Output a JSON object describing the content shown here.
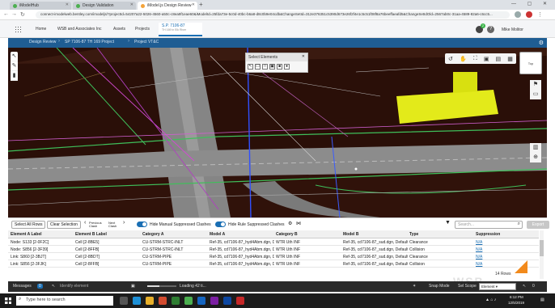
{
  "browser": {
    "tabs": [
      {
        "label": "iModelHub"
      },
      {
        "label": "Design Validation"
      },
      {
        "label": "iModel.js Design Review"
      }
    ],
    "url": "connect-imodelweb.bentley.com/imodeljs/?projectId=54207a22-5026-4560-a50c-c8ea9f1eae60&iModelId=25fda73e-5c0d-40bc-b6a8-d8c0b9e04cdb&ChangeSetId=312e376351c5390d673e26f2f4e1c5c51f08f8a76beeffaeafd5&ChangeSetIdOld=2567ab0c-31aa-4589-82a6-c6cc5..."
  },
  "app": {
    "nav": [
      "Home",
      "WSB and Associates Inc",
      "Assets",
      "Projects"
    ],
    "project_title": "S.P. 7106-87",
    "project_subtitle": "TH 169 in Elk River",
    "notification_count": "2",
    "help_label": "?",
    "user": "Mike Molitor"
  },
  "review_bar": {
    "breadcrumbs": [
      "Design Review",
      "SP 7106-87 TH 169 Project",
      "Project VT&C"
    ]
  },
  "select_panel": {
    "title": "Select Elements",
    "tools": [
      "↖",
      "☐",
      "□",
      "▣",
      "■",
      "●"
    ]
  },
  "view_tools": [
    "↺",
    "✋",
    "⛶",
    "▣",
    "▤",
    "▦"
  ],
  "cube_label": "Top",
  "grid_toolbar": {
    "select_all": "Select All Rows",
    "clear_selection": "Clear Selection",
    "previous": "Previous Clash",
    "next": "Next Clash",
    "hide_manual": "Hide Manual Suppressed Clashes",
    "hide_rule": "Hide Rule Suppressed Clashes",
    "search_placeholder": "Search...",
    "export": "Export"
  },
  "grid": {
    "columns": [
      "Element A Label",
      "Element B Label",
      "Category A",
      "Model A",
      "Category B",
      "Model B",
      "Type",
      "Suppression"
    ],
    "rows": [
      [
        "Node: S133 [2-0F2C]",
        "Cell [2-8BE5]",
        "CU-STRM-STRC-INLT",
        "Ref-35, cd7106-87_hyd4Abm.dgn, D",
        "WTR Uth INF",
        "Ref-35, cd7106-87_sud.dgn, Default",
        "Clearance",
        "N/A"
      ],
      [
        "Node: S856 [2-3F39]",
        "Cell [2-8FFB]",
        "CU-STRM-STRC-INLT",
        "Ref-35, cd7106-87_hyd4Abm.dgn, D",
        "WTR Uth INF",
        "Ref-35, cd7106-87_sud.dgn, Default",
        "Collision",
        "N/A"
      ],
      [
        "Link: S860 [2-3BJT]",
        "Cell [2-8BDT]",
        "CU-STRM-PIPE",
        "Ref-35, cd7106-87_hyd4Abm.dgn, D",
        "WTR Uth INF",
        "Ref-35, cd7106-87_sud.dgn, Default",
        "Clearance",
        "N/A"
      ],
      [
        "Link: S856 [2-3FJK]",
        "Cell [2-8FFB]",
        "CU-STRM-PIPE",
        "Ref-35, cd7106-87_hyd4Abm.dgn, D",
        "WTR Uth INF",
        "Ref-35, cd7106-87_sud.dgn, Default",
        "Collision",
        "N/A"
      ]
    ],
    "footer": "14 Rows"
  },
  "status_bar": {
    "messages": "Messages",
    "messages_count": "0",
    "tool_prompt": "Identify element",
    "loading": "Loading 42 ti...",
    "loading_progress": 0.42,
    "snap_label": "Snap Mode",
    "sel_scope": "Sel Scope",
    "scope_value": "Element",
    "selected_count": "0"
  },
  "taskbar": {
    "search_placeholder": "Type here to search",
    "time": "6:12 PM",
    "date": "12/5/2019"
  },
  "watermark": "WSB",
  "colors": {
    "accent": "#1a6fb4",
    "review_bar": "#1f5d93",
    "viewport_bg": "#2a0f08",
    "road": "#8c8c8c",
    "highlight": "#e3ea1a"
  }
}
